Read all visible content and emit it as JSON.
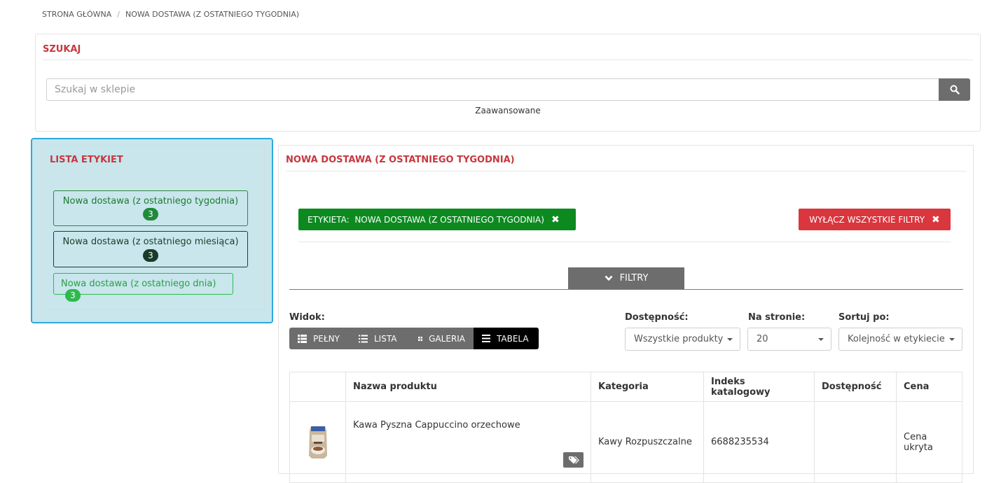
{
  "breadcrumb": {
    "home": "STRONA GŁÓWNA",
    "separator": "/",
    "current": "NOWA DOSTAWA (Z OSTATNIEGO TYGODNIA)"
  },
  "search": {
    "title": "SZUKAJ",
    "placeholder": "Szukaj w sklepie",
    "advanced_label": "Zaawansowane",
    "button_icon": "search-icon"
  },
  "labels_list": {
    "title": "LISTA ETYKIET",
    "items": [
      {
        "label": "Nowa dostawa (z ostatniego tygodnia)",
        "count": "3",
        "color": "#1f8a3b"
      },
      {
        "label": "Nowa dostawa (z ostatniego miesiąca)",
        "count": "3",
        "color": "#1a3a2a"
      },
      {
        "label": "Nowa dostawa (z ostatniego dnia)",
        "count": "3",
        "color": "#2fb94d"
      }
    ]
  },
  "main": {
    "title": "NOWA DOSTAWA (Z OSTATNIEGO TYGODNIA)",
    "active_filter": {
      "prefix": "ETYKIETA:",
      "value": "NOWA DOSTAWA (Z OSTATNIEGO TYGODNIA)",
      "color": "#0c8a20"
    },
    "clear_filters_label": "WYŁĄCZ WSZYSTKIE FILTRY",
    "filters_toggle_label": "FILTRY",
    "view": {
      "label": "Widok:",
      "options": [
        "PEŁNY",
        "LISTA",
        "GALERIA",
        "TABELA"
      ],
      "active": "TABELA"
    },
    "availability": {
      "label": "Dostępność:",
      "selected": "Wszystkie produkty"
    },
    "per_page": {
      "label": "Na stronie:",
      "selected": "20"
    },
    "sort": {
      "label": "Sortuj po:",
      "selected": "Kolejność w etykiecie"
    },
    "table": {
      "headers": [
        "",
        "Nazwa produktu",
        "Kategoria",
        "Indeks katalogowy",
        "Dostępność",
        "Cena"
      ],
      "rows": [
        {
          "name": "Kawa Pyszna Cappuccino orzechowe",
          "category": "Kawy Rozpuszczalne",
          "index": "6688235534",
          "availability": "",
          "price": "Cena ukryta"
        }
      ]
    }
  },
  "colors": {
    "accent_red": "#c7373f",
    "button_gray": "#6d6d6d",
    "danger": "#d9363e",
    "success": "#0c8a20",
    "selection_blue": "#30a8df"
  }
}
